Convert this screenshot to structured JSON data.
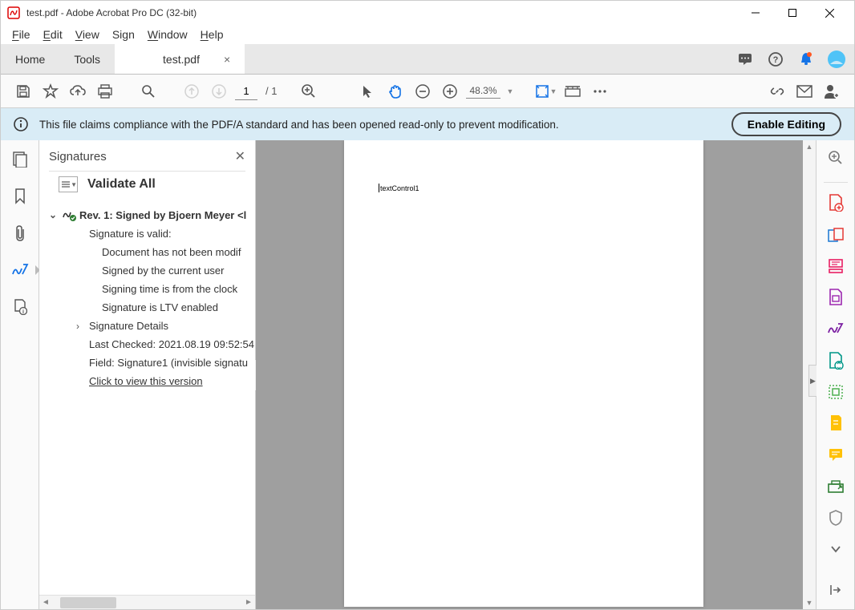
{
  "titlebar": {
    "text": "test.pdf - Adobe Acrobat Pro DC (32-bit)"
  },
  "menu": {
    "file": "File",
    "edit": "Edit",
    "view": "View",
    "sign": "Sign",
    "window": "Window",
    "help": "Help"
  },
  "tabs": {
    "home": "Home",
    "tools": "Tools",
    "doc": "test.pdf"
  },
  "toolbar": {
    "page_current": "1",
    "page_total": "/ 1",
    "zoom": "48.3%"
  },
  "infobar": {
    "message": "This file claims compliance with the PDF/A standard and has been opened read-only to prevent modification.",
    "button": "Enable Editing"
  },
  "sig_panel": {
    "title": "Signatures",
    "validate_all": "Validate All",
    "rev_label": "Rev. 1: Signed by Bjoern Meyer <l",
    "valid": "Signature is valid:",
    "not_modified": "Document has not been modif",
    "current_user": "Signed by the current user",
    "time_clock": "Signing time is from the clock",
    "ltv": "Signature is LTV enabled",
    "details": "Signature Details",
    "last_checked": "Last Checked: 2021.08.19 09:52:54",
    "field": "Field: Signature1 (invisible signatu",
    "view_version": "Click to view this version"
  },
  "document": {
    "content": "textControl1"
  }
}
